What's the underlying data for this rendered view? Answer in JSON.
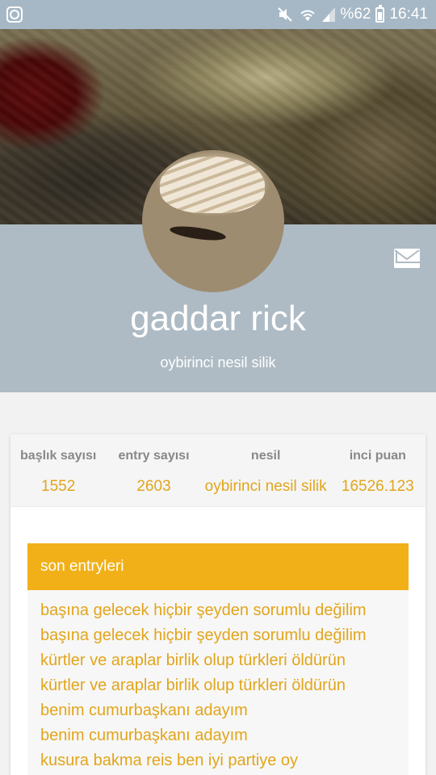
{
  "status_bar": {
    "notification_icon": "app-notification-icon",
    "icons": [
      "mute-icon",
      "wifi-icon",
      "signal-icon"
    ],
    "battery": "%62",
    "battery_fraction": 0.62,
    "time": "16:41"
  },
  "profile": {
    "username": "gaddar rick",
    "subtitle": "oybirinci nesil silik",
    "message_icon": "mail-icon"
  },
  "stats": [
    {
      "label": "başlık sayısı",
      "value": "1552"
    },
    {
      "label": "entry sayısı",
      "value": "2603"
    },
    {
      "label": "nesil",
      "value": "oybirinci nesil silik"
    },
    {
      "label": "inci puan",
      "value": "16526.123"
    }
  ],
  "entries": {
    "header": "son entryleri",
    "items": [
      "başına gelecek hiçbir şeyden sorumlu değilim",
      "başına gelecek hiçbir şeyden sorumlu değilim",
      "kürtler ve araplar birlik olup türkleri öldürün",
      "kürtler ve araplar birlik olup türkleri öldürün",
      "benim cumurbaşkanı adayım",
      "benim cumurbaşkanı adayım",
      "kusura bakma reis ben iyi partiye oy"
    ]
  },
  "colors": {
    "status_bar": "#a6b8c6",
    "profile_band": "#aebbc4",
    "accent": "#f2b018",
    "link": "#e2a51b"
  }
}
